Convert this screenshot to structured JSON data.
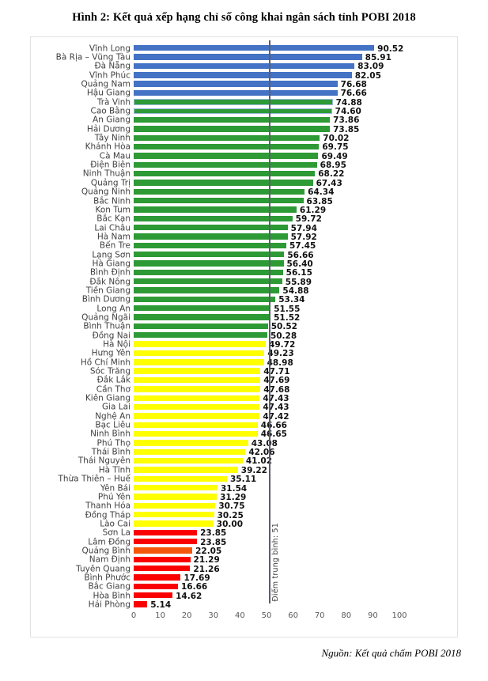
{
  "figure": {
    "title": "Hình 2: Kết quả xếp hạng chỉ số công khai ngân sách tỉnh POBI 2018",
    "source_note": "Nguồn: Kết quả chấm POBI 2018"
  },
  "colors": {
    "blue": "#4472c4",
    "green": "#2d9a35",
    "yellow": "#ffff00",
    "red": "#fa0000",
    "orange": "#f4560c",
    "outline_blue": "#9cb9e0",
    "average_line": "#5a5f6e"
  },
  "annotations": {
    "average_label": "Điểm trung bình: 51",
    "average_value": 51
  },
  "chart_data": {
    "type": "bar",
    "orientation": "horizontal",
    "title": "Hình 2: Kết quả xếp hạng chỉ số công khai ngân sách tỉnh POBI 2018",
    "xlabel": "",
    "ylabel": "",
    "xlim": [
      0,
      100
    ],
    "xticks": [
      "0",
      "10",
      "20",
      "30",
      "40",
      "50",
      "60",
      "70",
      "80",
      "90",
      "100"
    ],
    "grid": false,
    "legend_position": "none",
    "reference_line": {
      "value": 51,
      "label": "Điểm trung bình: 51"
    },
    "categories": [
      "Vĩnh Long",
      "Bà Rịa – Vũng Tàu",
      "Đà Nẵng",
      "Vĩnh Phúc",
      "Quảng Nam",
      "Hậu Giang",
      "Trà Vinh",
      "Cao Bằng",
      "An Giang",
      "Hải Dương",
      "Tây Ninh",
      "Khánh Hòa",
      "Cà Mau",
      "Điện Biên",
      "Ninh Thuận",
      "Quảng Trị",
      "Quảng Ninh",
      "Bắc Ninh",
      "Kon Tum",
      "Bắc Kạn",
      "Lai Châu",
      "Hà Nam",
      "Bến Tre",
      "Lạng Sơn",
      "Hà Giang",
      "Bình Định",
      "Đắk Nông",
      "Tiền Giang",
      "Bình Dương",
      "Long An",
      "Quảng Ngãi",
      "Bình Thuận",
      "Đồng Nai",
      "Hà Nội",
      "Hưng Yên",
      "Hồ Chí Minh",
      "Sóc Trăng",
      "Đắk Lắk",
      "Cần Thơ",
      "Kiên Giang",
      "Gia Lai",
      "Nghệ An",
      "Bạc Liêu",
      "Ninh Bình",
      "Phú Thọ",
      "Thái Bình",
      "Thái Nguyên",
      "Hà Tĩnh",
      "Thừa Thiên – Huế",
      "Yên Bái",
      "Phú Yên",
      "Thanh Hóa",
      "Đồng Tháp",
      "Lào Cai",
      "Sơn La",
      "Lâm Đồng",
      "Quảng Bình",
      "Nam Định",
      "Tuyên Quang",
      "Bình Phước",
      "Bắc Giang",
      "Hòa Bình",
      "Hải Phòng"
    ],
    "values": [
      90.52,
      85.91,
      83.09,
      82.05,
      76.68,
      76.66,
      74.88,
      74.6,
      73.86,
      73.85,
      70.02,
      69.75,
      69.49,
      68.95,
      68.22,
      67.43,
      64.34,
      63.85,
      61.29,
      59.72,
      57.94,
      57.92,
      57.45,
      56.66,
      56.4,
      56.15,
      55.89,
      54.88,
      53.34,
      51.55,
      51.52,
      50.52,
      50.28,
      49.72,
      49.23,
      48.98,
      47.71,
      47.69,
      47.68,
      47.43,
      47.43,
      47.42,
      46.66,
      46.65,
      43.08,
      42.06,
      41.02,
      39.22,
      35.11,
      31.54,
      31.29,
      30.75,
      30.25,
      30.0,
      23.85,
      23.85,
      22.05,
      21.29,
      21.26,
      17.69,
      16.66,
      14.62,
      5.14
    ],
    "value_labels": [
      "90.52",
      "85.91",
      "83.09",
      "82.05",
      "76.68",
      "76.66",
      "74.88",
      "74.60",
      "73.86",
      "73.85",
      "70.02",
      "69.75",
      "69.49",
      "68.95",
      "68.22",
      "67.43",
      "64.34",
      "63.85",
      "61.29",
      "59.72",
      "57.94",
      "57.92",
      "57.45",
      "56.66",
      "56.40",
      "56.15",
      "55.89",
      "54.88",
      "53.34",
      "51.55",
      "51.52",
      "50.52",
      "50.28",
      "49.72",
      "49.23",
      "48.98",
      "47.71",
      "47.69",
      "47.68",
      "47.43",
      "47.43",
      "47.42",
      "46.66",
      "46.65",
      "43.08",
      "42.06",
      "41.02",
      "39.22",
      "35.11",
      "31.54",
      "31.29",
      "30.75",
      "30.25",
      "30.00",
      "23.85",
      "23.85",
      "22.05",
      "21.29",
      "21.26",
      "17.69",
      "16.66",
      "14.62",
      "5.14"
    ],
    "bar_colors": [
      "blue",
      "blue",
      "blue",
      "blue",
      "blue",
      "blue",
      "green",
      "green",
      "green",
      "green",
      "green",
      "green",
      "green",
      "green",
      "green",
      "green",
      "green",
      "green",
      "green",
      "green",
      "green",
      "green",
      "green",
      "green",
      "green",
      "green",
      "green",
      "green",
      "green",
      "green",
      "green",
      "green",
      "green",
      "yellow",
      "yellow",
      "yellow",
      "yellow",
      "yellow",
      "yellow",
      "yellow",
      "yellow",
      "yellow",
      "yellow",
      "yellow",
      "yellow",
      "yellow",
      "yellow",
      "yellow",
      "yellow",
      "yellow",
      "yellow",
      "yellow",
      "yellow",
      "yellow",
      "red",
      "red",
      "orange",
      "red",
      "red",
      "red",
      "red",
      "red",
      "red"
    ],
    "bar_outlined": [
      false,
      false,
      false,
      false,
      false,
      false,
      true,
      true,
      false,
      false,
      false,
      false,
      false,
      false,
      false,
      false,
      false,
      false,
      false,
      false,
      false,
      false,
      false,
      false,
      false,
      false,
      false,
      false,
      false,
      false,
      false,
      false,
      false,
      false,
      false,
      false,
      false,
      false,
      false,
      false,
      false,
      false,
      false,
      false,
      false,
      false,
      false,
      false,
      false,
      false,
      false,
      false,
      false,
      false,
      false,
      false,
      false,
      false,
      false,
      false,
      false,
      false,
      false
    ]
  }
}
